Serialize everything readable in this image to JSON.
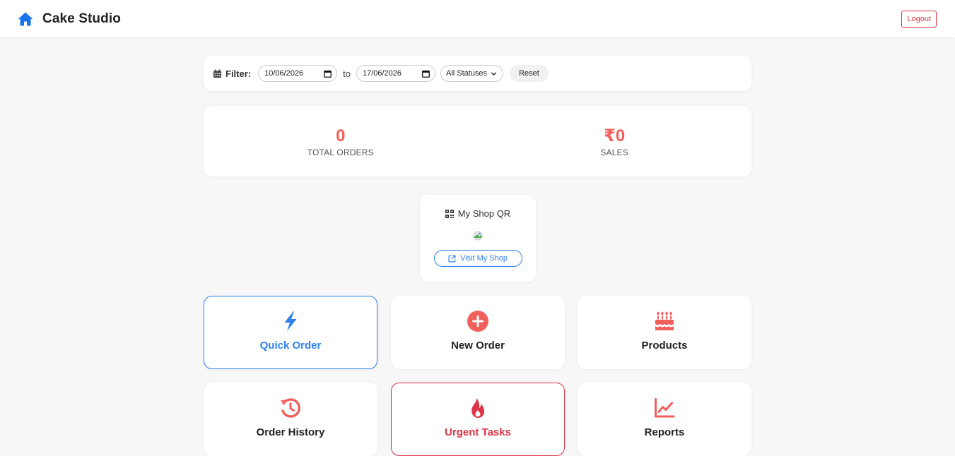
{
  "header": {
    "brand_icon": "home-icon",
    "title": "Cake Studio",
    "logout_label": "Logout"
  },
  "filter": {
    "label": "Filter:",
    "icon": "calendar-icon",
    "from_date": "10/06/2026",
    "to_text": "to",
    "to_date": "17/06/2026",
    "status_selected": "All Statuses",
    "reset_label": "Reset"
  },
  "stats": {
    "total_orders_value": "0",
    "total_orders_label": "TOTAL ORDERS",
    "sales_value": "₹0",
    "sales_label": "SALES"
  },
  "shop_qr": {
    "title": "My Shop QR",
    "visit_label": "Visit My Shop"
  },
  "tiles": [
    {
      "label": "Quick Order",
      "icon": "bolt-icon"
    },
    {
      "label": "New Order",
      "icon": "plus-circle-icon"
    },
    {
      "label": "Products",
      "icon": "cake-icon"
    },
    {
      "label": "Order History",
      "icon": "history-icon"
    },
    {
      "label": "Urgent Tasks",
      "icon": "fire-icon"
    },
    {
      "label": "Reports",
      "icon": "chart-line-icon"
    }
  ],
  "colors": {
    "accent_blue": "#2f80ed",
    "accent_red": "#dc3545",
    "stat_red": "#f0605d",
    "icon_coral": "#f0605d",
    "background": "#f7f7f8"
  }
}
